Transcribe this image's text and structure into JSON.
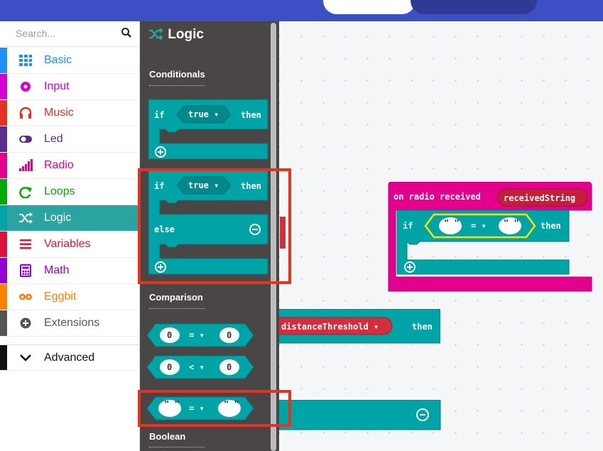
{
  "search": {
    "placeholder": "Search..."
  },
  "toolbox": {
    "categories": [
      {
        "label": "Basic",
        "color": "#1e90ff",
        "icon": "grid-icon"
      },
      {
        "label": "Input",
        "color": "#d400d4",
        "icon": "circle-dot-icon"
      },
      {
        "label": "Music",
        "color": "#e63022",
        "icon": "headphones-icon"
      },
      {
        "label": "Led",
        "color": "#5c2d91",
        "icon": "toggle-icon"
      },
      {
        "label": "Radio",
        "color": "#e3008c",
        "icon": "signal-bars-icon"
      },
      {
        "label": "Loops",
        "color": "#00aa00",
        "icon": "loop-arrow-icon"
      },
      {
        "label": "Logic",
        "color": "#00a4a6",
        "icon": "shuffle-icon",
        "selected": true
      },
      {
        "label": "Variables",
        "color": "#dc143c",
        "icon": "list-icon"
      },
      {
        "label": "Math",
        "color": "#9400d3",
        "icon": "calculator-icon"
      },
      {
        "label": "Eggbit",
        "color": "#ff7f00",
        "icon": "glasses-icon"
      },
      {
        "label": "Extensions",
        "color": "#555555",
        "icon": "plus-circle-icon"
      }
    ],
    "advanced_label": "Advanced"
  },
  "flyout": {
    "title": "Logic",
    "sections": {
      "conditionals": "Conditionals",
      "comparison": "Comparison",
      "boolean": "Boolean"
    },
    "if_label": "if",
    "then_label": "then",
    "else_label": "else",
    "true_label": "true ▾",
    "cmp1": {
      "left": "0",
      "op": "= ▾",
      "right": "0"
    },
    "cmp2": {
      "left": "0",
      "op": "< ▾",
      "right": "0"
    },
    "cmp3": {
      "left": "\" \"",
      "op": "= ▾",
      "right": "\" \""
    }
  },
  "workspace": {
    "radio_event": "on radio received",
    "radio_param": "receivedString",
    "if_label": "if",
    "then_label": "then",
    "eq_op": "= ▾",
    "str_left": "\" \"",
    "str_right": "\" \"",
    "partial_var": "distanceThreshold ▾",
    "partial_then": "then"
  },
  "colors": {
    "logic": "#00a4a6",
    "radio": "#e3008c",
    "variables": "#d12e3e",
    "highlight": "#e8321b",
    "header": "#3d4fc4"
  }
}
